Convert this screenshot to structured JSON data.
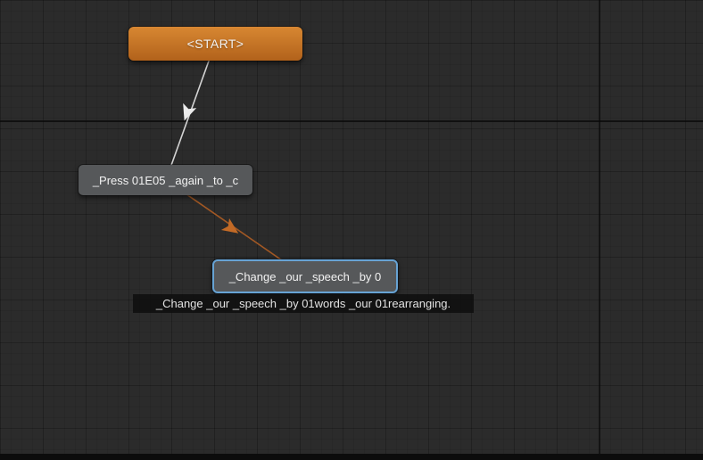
{
  "app": {
    "name": "dialogue-node-editor"
  },
  "canvas": {
    "background_color": "#2b2b2b",
    "grid_minor_color": "#272727",
    "grid_major_color": "#222222",
    "origin_line_color": "#0e0e0e",
    "bottom_bar_color": "#0c0c0c"
  },
  "nodes": {
    "start": {
      "label": "<START>",
      "type": "start",
      "color": "#c9772b",
      "selected": false
    },
    "press": {
      "label": "_Press 01E05 _again _to _c",
      "type": "dialogue",
      "color": "#56585a",
      "selected": false
    },
    "change": {
      "label": "_Change _our _speech _by 0",
      "type": "dialogue",
      "color": "#56585a",
      "selected": true,
      "selection_color": "#67a3d4"
    }
  },
  "links": [
    {
      "from": "start",
      "to": "press",
      "color": "#d4d4d4",
      "arrow_color": "#ebebeb"
    },
    {
      "from": "press",
      "to": "change",
      "color": "#a25824",
      "arrow_color": "#c26a26"
    }
  ],
  "tooltip": {
    "text": "_Change _our _speech _by 01words _our 01rearranging."
  }
}
